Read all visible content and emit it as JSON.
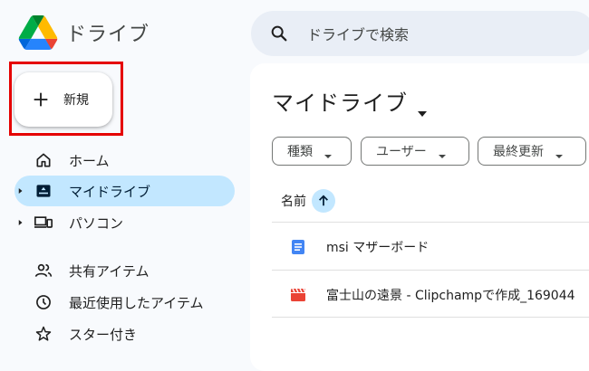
{
  "header": {
    "app_title": "ドライブ",
    "search_placeholder": "ドライブで検索"
  },
  "new_button": {
    "label": "新規"
  },
  "sidebar": {
    "items": [
      {
        "label": "ホーム",
        "icon": "home-icon"
      },
      {
        "label": "マイドライブ",
        "icon": "my-drive-icon",
        "active": true,
        "expandable": true
      },
      {
        "label": "パソコン",
        "icon": "computers-icon",
        "expandable": true
      },
      {
        "label": "共有アイテム",
        "icon": "shared-icon"
      },
      {
        "label": "最近使用したアイテム",
        "icon": "recent-clock-icon"
      },
      {
        "label": "スター付き",
        "icon": "star-icon"
      }
    ]
  },
  "main": {
    "title": "マイドライブ",
    "filters": [
      {
        "label": "種類"
      },
      {
        "label": "ユーザー"
      },
      {
        "label": "最終更新"
      }
    ],
    "column_name": "名前",
    "files": [
      {
        "name": "msi マザーボード",
        "type": "google-docs"
      },
      {
        "name": "富士山の遠景 - Clipchampで作成_169044",
        "type": "video"
      }
    ]
  },
  "colors": {
    "accent": "#c2e7ff",
    "background": "#f8fafd",
    "search_bg": "#e9eef6",
    "annotation_red": "#e50000",
    "docs_blue": "#4285f4",
    "video_red": "#ea4335"
  }
}
